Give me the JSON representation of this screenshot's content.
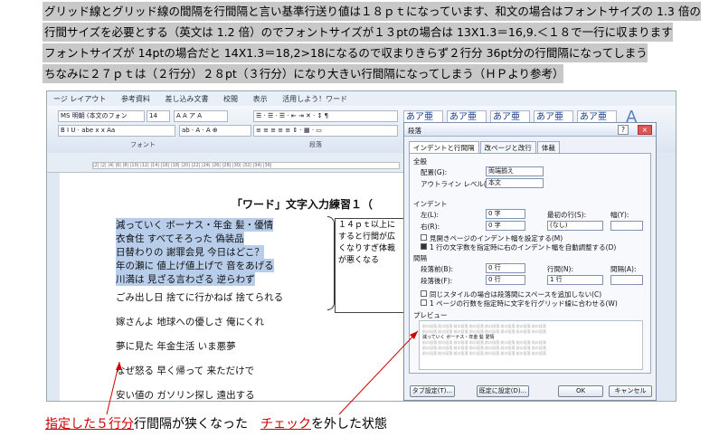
{
  "highlights": [
    "グリッド線とグリッド線の間隔を行間隔と言い基準行送り値は１８ｐｔになっています、和文の場合はフォントサイズの 1.3 倍の",
    "行間サイズを必要とする（英文は 1.2 倍）のでフォントサイズが１３ptの場合は 13X1.3＝16,9.＜１８で一行に収まります",
    "フォントサイズが 14ptの場合だと 14X1.3＝18,2>18になるので収まりきらず２行分 36pt分の行間隔になってしまう",
    "ちなみに２７ｐｔは（２行分）２８pt（３行分）になり大きい行間隔になってしまう（ＨＰより参考）"
  ],
  "menubar": [
    "ージ レイアウト",
    "参考資料",
    "差し込み文書",
    "校閲",
    "表示",
    "活用しよう！ワード"
  ],
  "ribbon": {
    "font_name": "MS 明朝 (本文のフォン",
    "font_size": "14",
    "group_font": "フォント",
    "group_paragraph": "段落",
    "styles": [
      "あア亜",
      "あア亜",
      "あア亜",
      "あア亜",
      "あア亜"
    ]
  },
  "document": {
    "title": "「ワード」文字入力練習１（",
    "lines": [
      "減っていく ボーナス・年金 髪・優情",
      "衣食住 すべてそろった 偽装品",
      "日替わりの 謝罪会見 今日はどこ？",
      "年の瀬に 値上げ値上げで 音をあげる",
      "川満は 見ざる言わざる 逆らわず",
      "ごみ出し日 捨てに行かねば 捨てられる",
      "嫁さんよ 地球への優しさ 俺にくれ",
      "夢に見た 年金生活 いま悪夢",
      "なぜ怒る 早く帰って 来ただけで",
      "安い値の ガソリン探し 遠出する"
    ],
    "side_note": "１４ｐｔ以上にすると行間が広くなりすぎ体裁が悪くなる"
  },
  "dialog": {
    "title": "段落",
    "tabs": [
      "インデントと行間隔",
      "改ページと改行",
      "体裁"
    ],
    "general_label": "全般",
    "alignment_label": "配置(G):",
    "alignment_value": "両端揃え",
    "outline_label": "アウトライン レベル(O):",
    "outline_value": "本文",
    "indent_label": "インデント",
    "left_label": "左(L):",
    "left_value": "0 字",
    "right_label": "右(R):",
    "right_value": "0 字",
    "first_line_label": "最初の行(S):",
    "first_line_value": "(なし)",
    "width_label": "幅(Y):",
    "mirror_label": "見開きページのインデント幅を設定する(M)",
    "auto_indent_label": "1 行の文字数を指定時に右のインデント幅を自動調整する(D)",
    "spacing_label": "間隔",
    "before_label": "段落前(B):",
    "before_value": "0 行",
    "after_label": "段落後(F):",
    "after_value": "0 行",
    "line_spacing_label": "行間(N):",
    "line_spacing_value": "1 行",
    "at_label": "間隔(A):",
    "no_space_label": "同じスタイルの場合は段落間にスペースを追加しない(C)",
    "snap_grid_label": "1 ページの行数を指定時に文字を行グリッド線に合わせる(W)",
    "preview_label": "プレビュー",
    "preview_text": "前の段落 前の段落 前の段落 前の段落 前の段落 前の段落 前の段落 前の段落",
    "preview_sample": "減っていく ボーナス・年金 髪 愛情",
    "tab_button": "タブ設定(T)...",
    "default_button": "既定に設定(D)...",
    "ok_button": "OK",
    "cancel_button": "キャンセル"
  },
  "caption": {
    "part1": "指定した５行分",
    "part2": "行間隔が狭くなった",
    "part3": "チェック",
    "part4": "を外した状態"
  },
  "colors": {
    "highlight_bg": "#c8c8c8",
    "selection": "#b7cdea",
    "arrow": "#d00000"
  }
}
